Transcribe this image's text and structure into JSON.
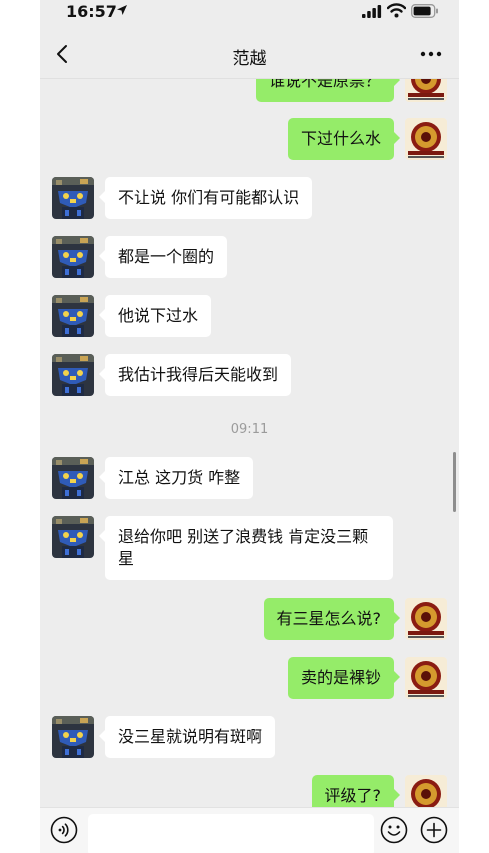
{
  "status_bar": {
    "time": "16:57"
  },
  "header": {
    "title": "范越"
  },
  "messages": [
    {
      "side": "out",
      "text": "谁说不是原票？"
    },
    {
      "side": "out",
      "text": "下过什么水"
    },
    {
      "side": "in",
      "text": "不让说  你们有可能都认识"
    },
    {
      "side": "in",
      "text": "都是一个圈的"
    },
    {
      "side": "in",
      "text": "他说下过水"
    },
    {
      "side": "in",
      "text": "我估计我得后天能收到"
    },
    {
      "side": "in",
      "text": "江总  这刀货  咋整"
    },
    {
      "side": "in",
      "text": "退给你吧  别送了浪费钱  肯定没三颗星"
    },
    {
      "side": "out",
      "text": "有三星怎么说?"
    },
    {
      "side": "out",
      "text": "卖的是裸钞"
    },
    {
      "side": "in",
      "text": "没三星就说明有斑啊"
    },
    {
      "side": "out",
      "text": "评级了?"
    }
  ],
  "timestamp": "09:11",
  "input": {
    "value": "",
    "placeholder": ""
  },
  "colors": {
    "outgoing_bubble": "#95ec69",
    "incoming_bubble": "#ffffff",
    "background": "#ededed"
  },
  "icons": {
    "back": "chevron-left-icon",
    "more": "more-dots-icon",
    "voice": "voice-icon",
    "emoji": "emoji-icon",
    "plus": "plus-icon"
  }
}
